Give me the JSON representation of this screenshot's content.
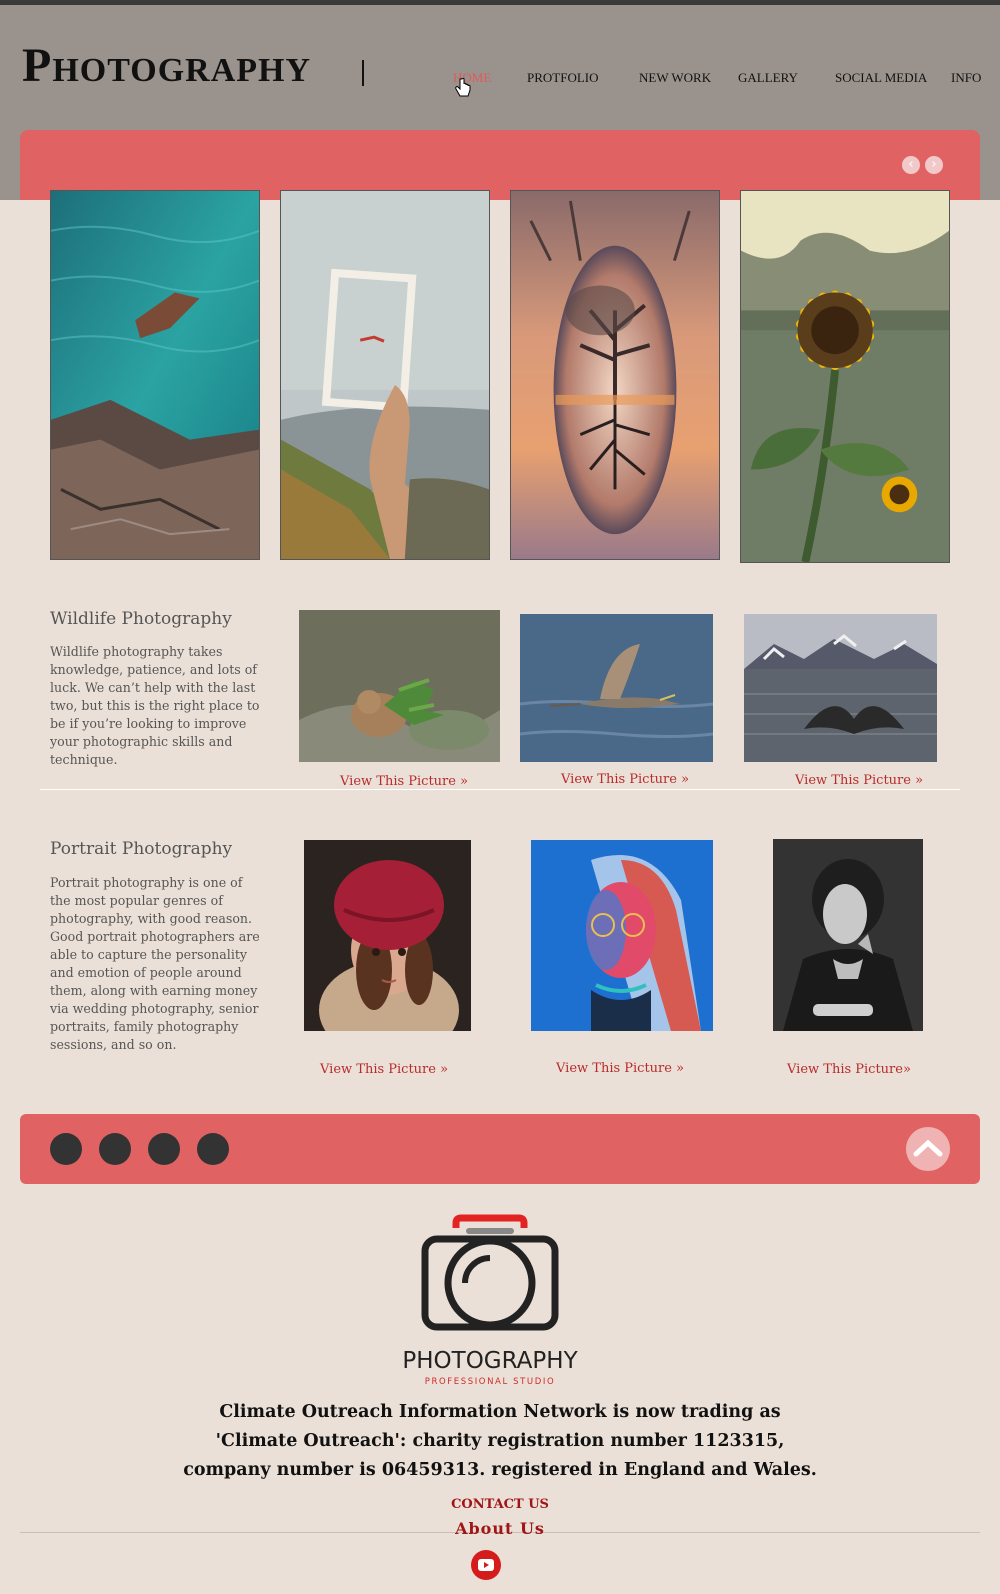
{
  "header": {
    "logo": "Photography",
    "nav": [
      "HOME",
      "PROTFOLIO",
      "NEW WORK",
      "GALLERY",
      "SOCIAL MEDIA",
      "INFO"
    ],
    "active_index": 0
  },
  "slider": {
    "prev_icon": "‹",
    "next_icon": "›",
    "images": [
      "sea-rocks-photo",
      "frame-hand-photo",
      "crystal-ball-tree-photo",
      "sunflower-photo"
    ]
  },
  "wildlife": {
    "title": "Wildlife Photography",
    "text": "Wildlife photography takes knowledge, patience, and lots of luck. We can’t help with the last two, but this is the right place to be if you’re looking to improve your photographic skills and technique.",
    "links": [
      "View This Picture »",
      "View This Picture »",
      "View This Picture »"
    ]
  },
  "portrait": {
    "title": "Portrait Photography",
    "text": "Portrait photography is one of the most popular genres of photography, with good reason. Good portrait photographers are able to capture the personality and emotion of people around them, along with earning money via wedding photography, senior portraits, family photography sessions, and so on.",
    "links": [
      "View This Picture »",
      "View This Picture »",
      "View This Picture»"
    ]
  },
  "footer": {
    "logo_title": "PHOTOGRAPHY",
    "logo_subtitle": "PROFESSIONAL STUDIO",
    "notice": "Climate Outreach Information Network is now trading as 'Climate Outreach': charity registration number 1123315, company number is 06459313. registered in England and Wales.",
    "contact": "CONTACT US",
    "about": "About Us"
  },
  "colors": {
    "accent": "#e06262",
    "header_bg": "#9a938d",
    "page_bg": "#ebe0d7",
    "link": "#b82b2b"
  }
}
